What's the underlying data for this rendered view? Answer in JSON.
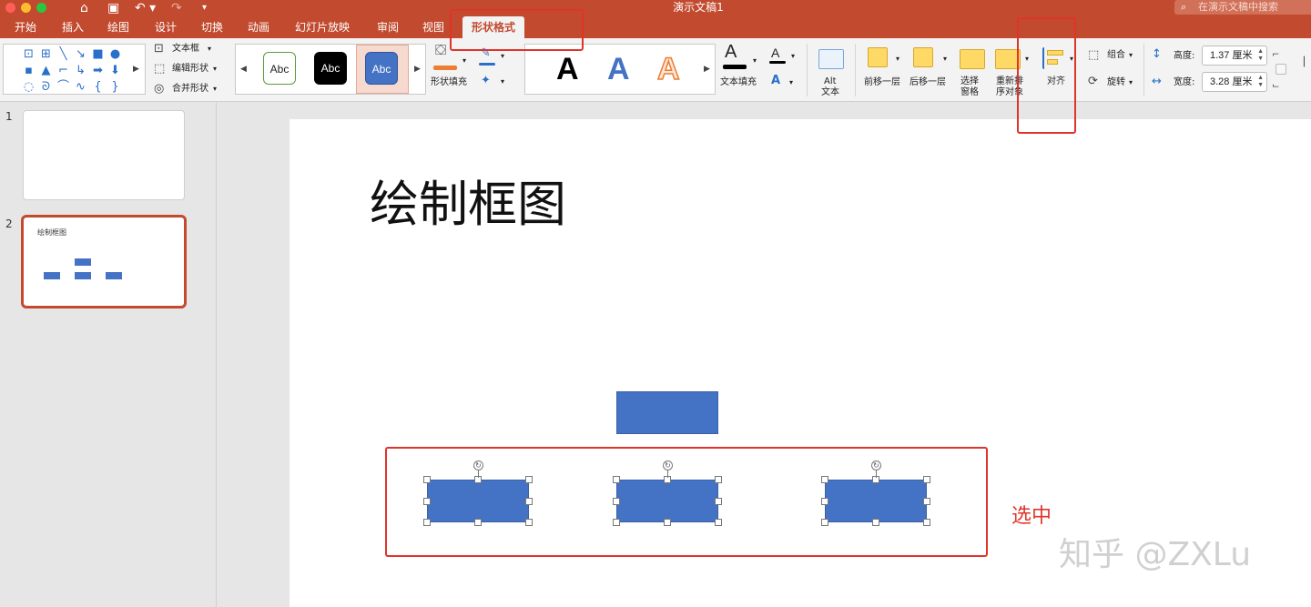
{
  "window": {
    "title": "演示文稿1",
    "search_placeholder": "在演示文稿中搜索"
  },
  "tabs": [
    {
      "label": "开始"
    },
    {
      "label": "插入"
    },
    {
      "label": "绘图"
    },
    {
      "label": "设计"
    },
    {
      "label": "切换"
    },
    {
      "label": "动画"
    },
    {
      "label": "幻灯片放映"
    },
    {
      "label": "审阅"
    },
    {
      "label": "视图"
    },
    {
      "label": "形状格式",
      "active": true
    }
  ],
  "ribbon": {
    "insert_shapes": {
      "text_box": "文本框",
      "edit_shape": "编辑形状",
      "merge_shapes": "合并形状"
    },
    "shape_styles": {
      "style1": "Abc",
      "style2": "Abc",
      "style3": "Abc",
      "fill_label": "形状填充"
    },
    "wordart": {
      "letter": "A",
      "text_fill_label": "文本填充"
    },
    "alt_text": {
      "line1": "Alt",
      "line2": "文本"
    },
    "arrange": {
      "bring_forward": "前移一层",
      "send_backward": "后移一层",
      "selection_pane_1": "选择",
      "selection_pane_2": "窗格",
      "reorder_1": "重新排",
      "reorder_2": "序对象",
      "align": "对齐",
      "group": "组合",
      "rotate": "旋转"
    },
    "size": {
      "height_label": "高度:",
      "height_value": "1.37 厘米",
      "width_label": "宽度:",
      "width_value": "3.28 厘米"
    }
  },
  "slides_panel": [
    {
      "number": "1",
      "title": ""
    },
    {
      "number": "2",
      "title": "绘制框图",
      "selected": true
    }
  ],
  "slide": {
    "title": "绘制框图"
  },
  "annotation": "选中",
  "watermark": "知乎 @ZXLu",
  "colors": {
    "accent": "#c24a2e",
    "shape_fill": "#4472c4",
    "highlight": "#e0342b"
  },
  "icons": [
    "home-icon",
    "save-icon",
    "undo-icon",
    "redo-icon",
    "search-icon",
    "rotate-handle-icon"
  ]
}
